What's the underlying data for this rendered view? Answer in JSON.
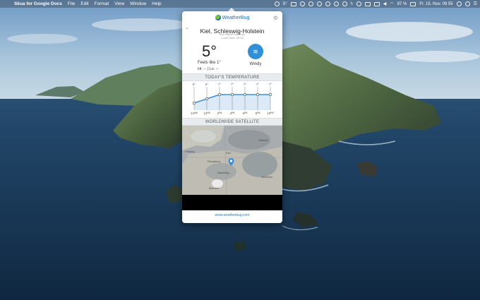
{
  "menubar": {
    "app_name": "Skua for Google Docs",
    "menus": [
      "File",
      "Edit",
      "Format",
      "View",
      "Window",
      "Help"
    ],
    "weather_temp": "5°",
    "battery": "97 %",
    "datetime": "Fr. 15. Nov.  09 55"
  },
  "popover": {
    "brand": "WeatherBug",
    "city": "Kiel, Schleswig-Holstein",
    "station": "Kiel Airport Holtenau",
    "local_time": "Local Time: 09:54",
    "temp": "5°",
    "feels_like": "Feels like  1°",
    "hilo": "Hi:  --     | Lo:  --",
    "condition": "Windy",
    "section_temperature": "TODAY'S TEMPERATURE",
    "section_satellite": "WORLDWIDE SATELLITE",
    "footer_link": "www.weatherbug.com"
  },
  "chart_data": {
    "type": "line",
    "title": "TODAY'S TEMPERATURE",
    "x": [
      "10AM",
      "12PM",
      "2PM",
      "4PM",
      "6PM",
      "8PM",
      "10PM"
    ],
    "series": [
      {
        "values": [
          5,
          6,
          7,
          7,
          7,
          7,
          7
        ]
      }
    ],
    "value_labels": [
      "5°",
      "6°",
      "7°",
      "7°",
      "7°",
      "7°",
      "7°"
    ],
    "time_labels": [
      "10ᴬᴹ",
      "12ᴾᴹ",
      "2ᴾᴹ",
      "4ᴾᴹ",
      "6ᴾᴹ",
      "8ᴾᴹ",
      "10ᴾᴹ"
    ],
    "ylim": [
      4,
      8
    ],
    "color": "#3a8fd6"
  },
  "map": {
    "labels": [
      "Esbjerg",
      "Flensburg",
      "Kiel",
      "Hamburg",
      "Bremen",
      "Szczecin",
      "Gdańsk"
    ]
  }
}
